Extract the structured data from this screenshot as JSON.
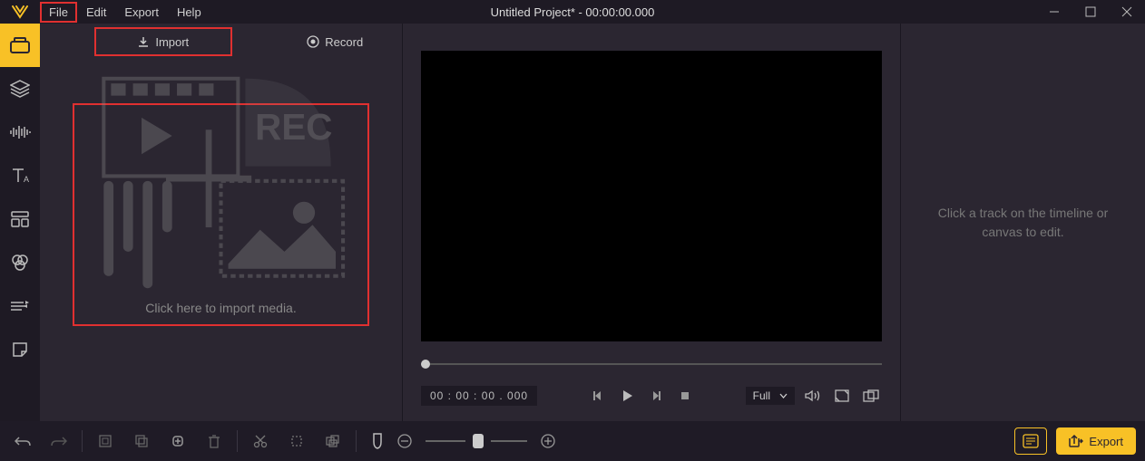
{
  "menubar": {
    "file": "File",
    "edit": "Edit",
    "export": "Export",
    "help": "Help"
  },
  "title": "Untitled Project* - 00:00:00.000",
  "media": {
    "import_label": "Import",
    "record_label": "Record",
    "import_hint": "Click here to import media."
  },
  "preview": {
    "timecode": "00 : 00 : 00 . 000",
    "zoom_label": "Full"
  },
  "props": {
    "hint": "Click a track on the timeline or canvas to edit."
  },
  "bottombar": {
    "export_label": "Export"
  }
}
